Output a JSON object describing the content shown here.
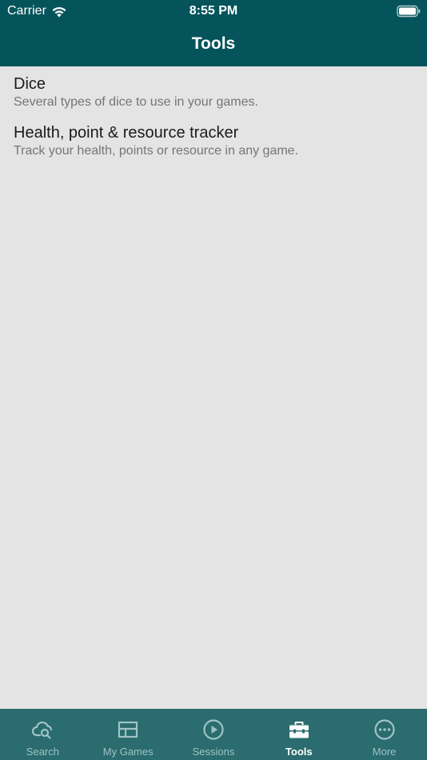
{
  "status_bar": {
    "carrier": "Carrier",
    "time": "8:55 PM"
  },
  "nav": {
    "title": "Tools"
  },
  "tools": [
    {
      "title": "Dice",
      "subtitle": "Several types of dice to use in your games."
    },
    {
      "title": "Health, point & resource tracker",
      "subtitle": "Track your health, points or resource in any game."
    }
  ],
  "tabbar": {
    "active": "Tools",
    "items": [
      {
        "label": "Search",
        "icon": "cloud-search-icon"
      },
      {
        "label": "My Games",
        "icon": "layout-grid-icon"
      },
      {
        "label": "Sessions",
        "icon": "play-circle-icon"
      },
      {
        "label": "Tools",
        "icon": "toolbox-icon"
      },
      {
        "label": "More",
        "icon": "more-circle-icon"
      }
    ]
  },
  "colors": {
    "header": "#05545b",
    "tabbar": "#2a6c6f",
    "background": "#e4e4e4",
    "tab_inactive": "#9fc4c4",
    "tab_active": "#ffffff"
  }
}
